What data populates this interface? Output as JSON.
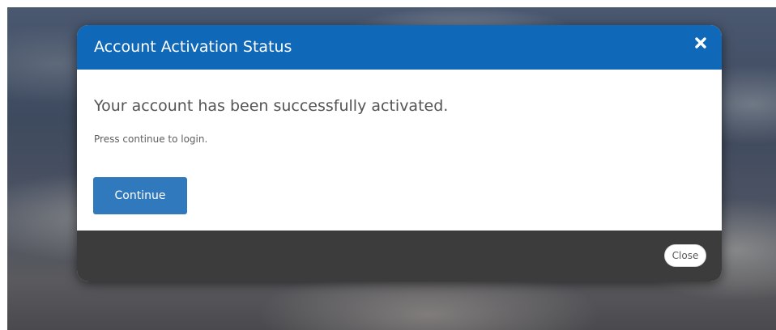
{
  "modal": {
    "title": "Account Activation Status",
    "close_icon": "close-x-icon",
    "headline": "Your account has been successfully activated.",
    "subtext": "Press continue to login.",
    "continue_label": "Continue",
    "close_label": "Close"
  },
  "colors": {
    "header": "#0f68b8",
    "continue_button": "#3179bd",
    "footer": "#3c3c3c"
  }
}
